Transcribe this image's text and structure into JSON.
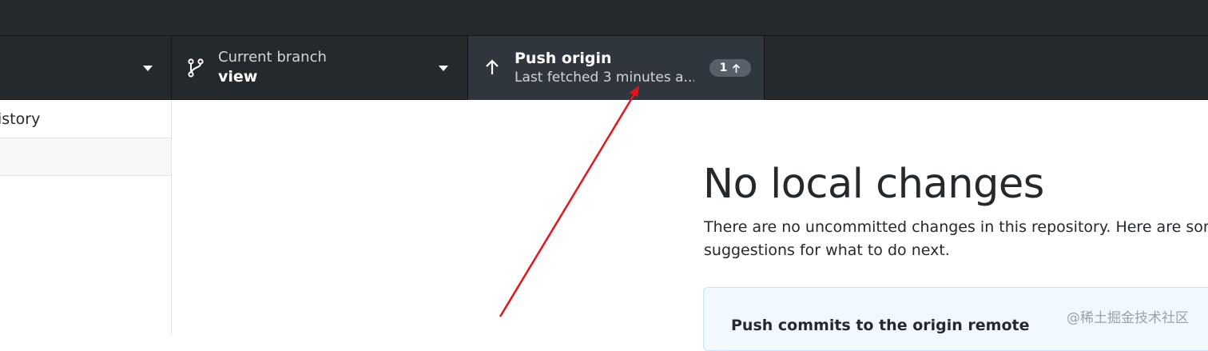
{
  "toolbar": {
    "current_branch": {
      "label": "Current branch",
      "value": "view"
    },
    "push": {
      "title": "Push origin",
      "subtitle": "Last fetched 3 minutes a...",
      "badge_count": "1"
    }
  },
  "sidebar": {
    "tab_label": "istory"
  },
  "main": {
    "title": "No local changes",
    "description": "There are no uncommitted changes in this repository. Here are some suggestions for what to do next.",
    "suggestion_title": "Push commits to the origin remote"
  },
  "watermark": "@稀土掘金技术社区",
  "icons": {
    "branch": "git-branch-icon",
    "push": "arrow-up-icon",
    "dropdown": "caret-down-icon"
  },
  "colors": {
    "toolbar_bg": "#24292e",
    "active_section_bg": "#2f363d",
    "badge_bg": "#586069",
    "annotation_arrow": "#e8141b",
    "card_bg": "#f1f8ff"
  }
}
